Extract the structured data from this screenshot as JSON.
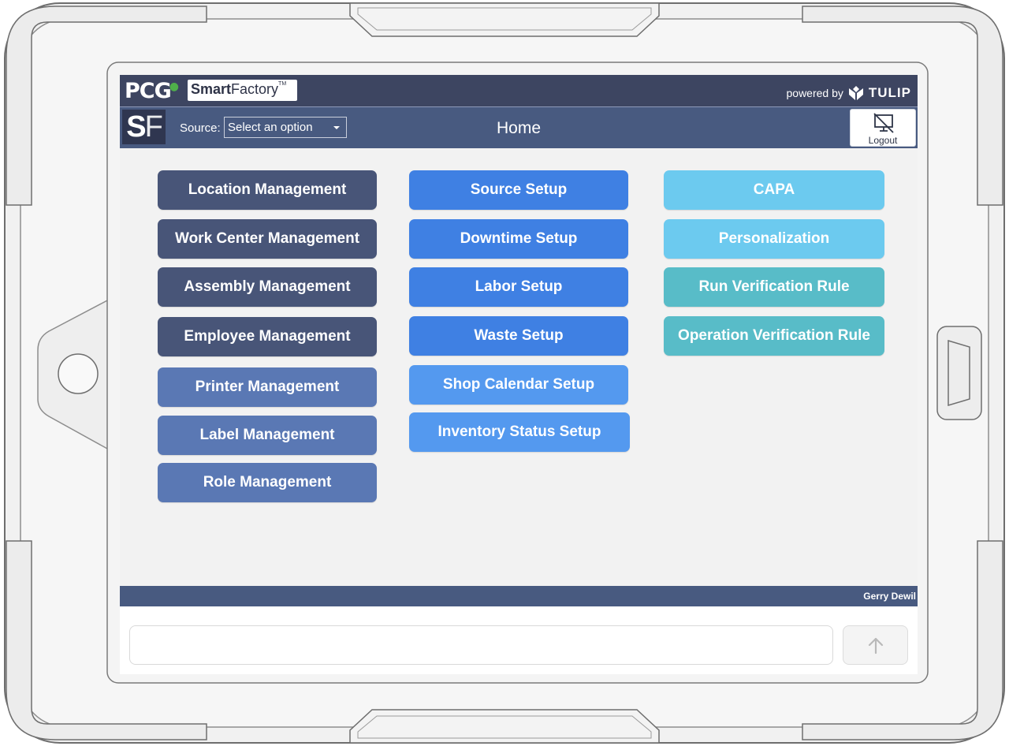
{
  "header": {
    "logo_pcg": "PCG",
    "logo_smart": "Smart",
    "logo_factory": "Factory",
    "logo_tm": "TM",
    "powered_by": "powered by",
    "tulip": "TULIP"
  },
  "navbar": {
    "badge_s": "S",
    "badge_f": "F",
    "source_label": "Source:",
    "source_value": "Select an option",
    "title": "Home",
    "logout_label": "Logout"
  },
  "colors": {
    "dark_slate": "#485578",
    "steel": "#5a78b4",
    "blue": "#3f80e3",
    "light_blue": "#5499ef",
    "sky": "#6ccaef",
    "teal": "#58bcc8"
  },
  "menu": {
    "column1": [
      {
        "label": "Location Management",
        "color": "#485578"
      },
      {
        "label": "Work Center Management",
        "color": "#485578"
      },
      {
        "label": "Assembly Management",
        "color": "#485578"
      },
      {
        "label": "Employee Management",
        "color": "#485578"
      },
      {
        "label": "Printer Management",
        "color": "#5a78b4"
      },
      {
        "label": "Label Management",
        "color": "#5a78b4"
      },
      {
        "label": "Role Management",
        "color": "#5a78b4"
      }
    ],
    "column2": [
      {
        "label": "Source Setup",
        "color": "#3f80e3"
      },
      {
        "label": "Downtime Setup",
        "color": "#3f80e3"
      },
      {
        "label": "Labor Setup",
        "color": "#3f80e3"
      },
      {
        "label": "Waste Setup",
        "color": "#3f80e3"
      },
      {
        "label": "Shop Calendar Setup",
        "color": "#5499ef"
      },
      {
        "label": "Inventory Status Setup",
        "color": "#5499ef"
      }
    ],
    "column3": [
      {
        "label": "CAPA",
        "color": "#6ccaef"
      },
      {
        "label": "Personalization",
        "color": "#6ccaef"
      },
      {
        "label": "Run Verification Rule",
        "color": "#58bcc8"
      },
      {
        "label": "Operation Verification Rule",
        "color": "#58bcc8"
      }
    ]
  },
  "footer": {
    "user_name": "Gerry Dewil"
  },
  "chat": {
    "input_value": "",
    "send_icon": "arrow-up-icon"
  }
}
